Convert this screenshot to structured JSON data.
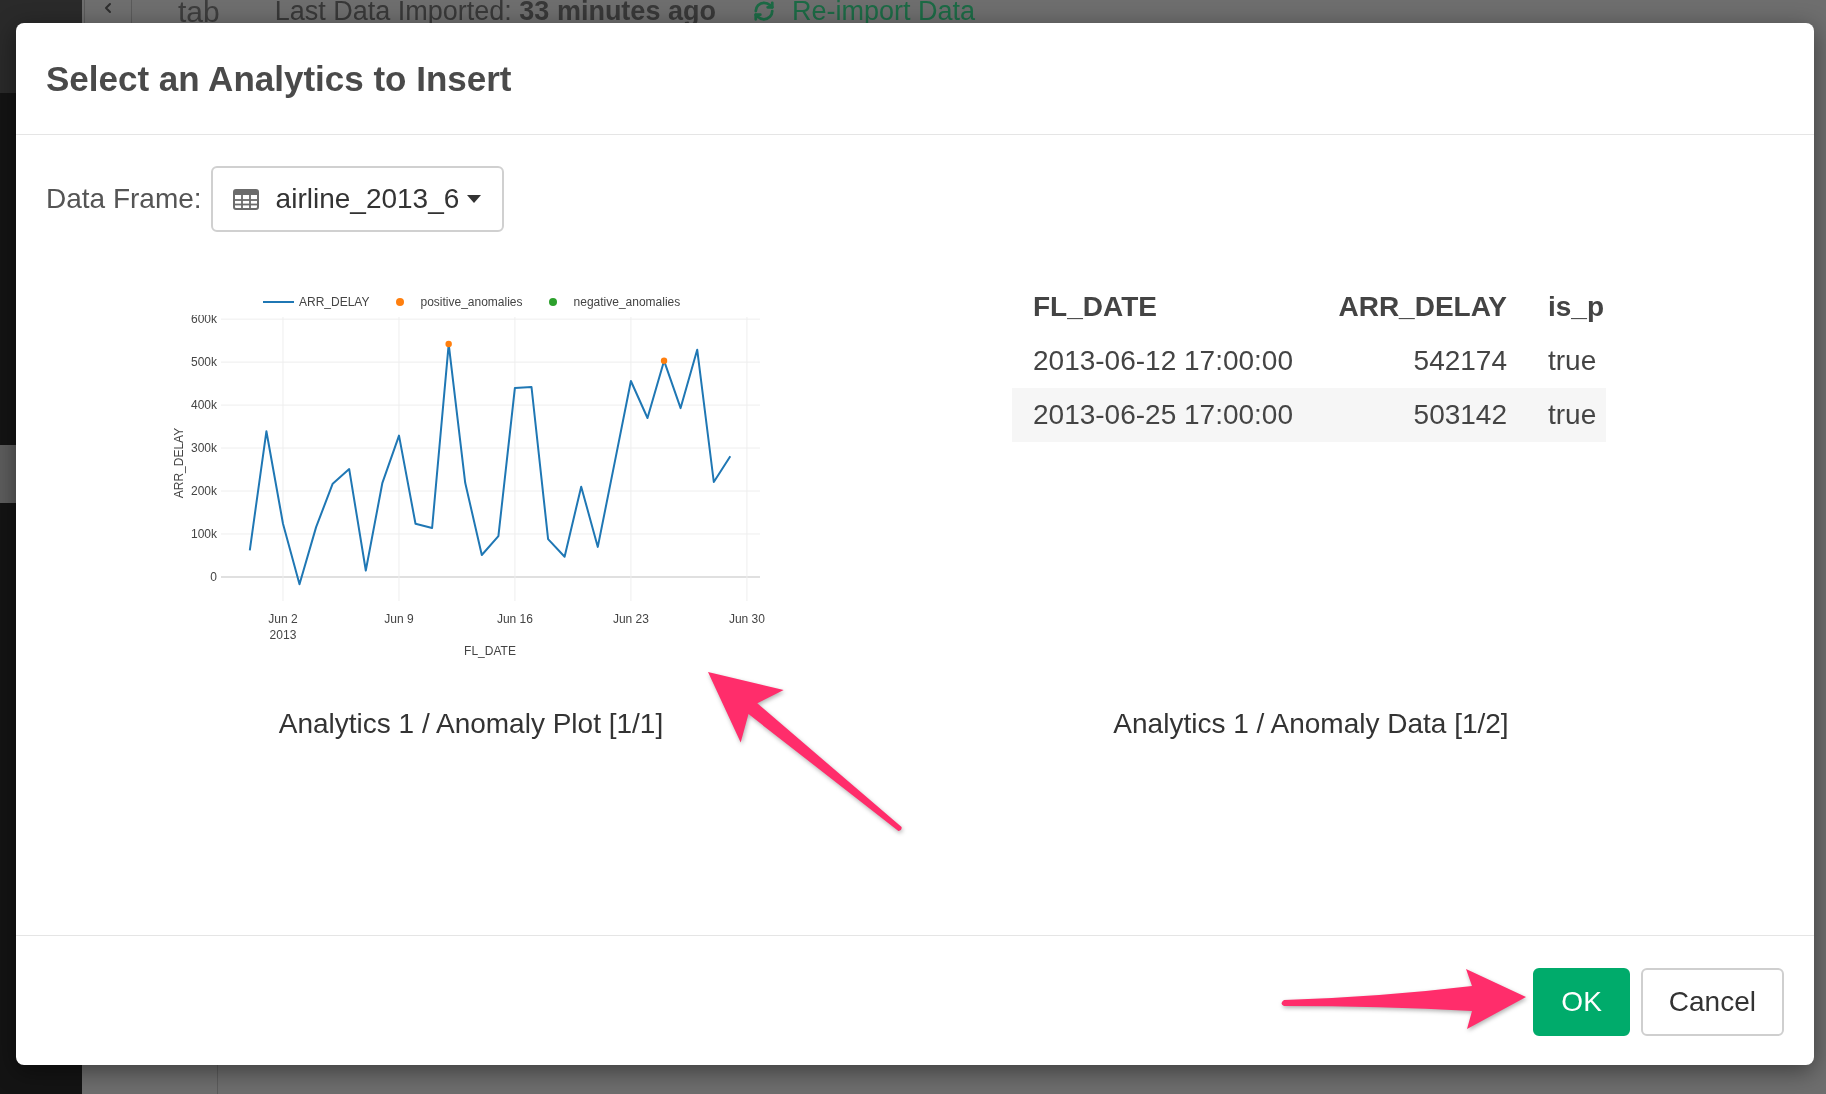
{
  "page": {
    "header": {
      "logo_fragment": "tab",
      "import_status": "Last Data Imported: **33 minutes ago**",
      "reimport_link": "Re-import Data"
    }
  },
  "dialog": {
    "title": "Select an Analytics to Insert",
    "data_frame": {
      "label": "Data Frame:",
      "value": "airline_2013_6"
    },
    "analytics": [
      {
        "kind": "plot",
        "caption": "Analytics 1 / Anomaly Plot [1/1]",
        "chart_data": {
          "type": "line",
          "xlabel": "FL_DATE",
          "ylabel": "ARR_DELAY",
          "grid": true,
          "legend": "top",
          "categories": [
            null,
            null,
            "Jun 2\n2013",
            null,
            null,
            null,
            null,
            null,
            null,
            "Jun 9",
            null,
            null,
            null,
            null,
            null,
            null,
            "Jun 16",
            null,
            null,
            null,
            null,
            null,
            null,
            "Jun 23",
            null,
            null,
            null,
            null,
            null,
            null,
            "Jun 30"
          ],
          "series": [
            {
              "name": "ARR_DELAY",
              "color": "#1f77b4",
              "values": [
                62000,
                339000,
                124000,
                -17000,
                116000,
                217000,
                251000,
                15000,
                219000,
                329000,
                124000,
                114000,
                542000,
                219000,
                51000,
                95000,
                440000,
                442000,
                88000,
                47000,
                210000,
                70000,
                263000,
                456000,
                370000,
                503000,
                393000,
                529000,
                221000,
                281000,
                null
              ]
            },
            {
              "name": "positive_anomalies",
              "type": "scatter",
              "color": "#ff7f0e",
              "values": [
                null,
                null,
                null,
                null,
                null,
                null,
                null,
                null,
                null,
                null,
                null,
                null,
                542000,
                null,
                null,
                null,
                null,
                null,
                null,
                null,
                null,
                null,
                null,
                null,
                null,
                503000,
                null,
                null,
                null,
                null,
                null
              ]
            },
            {
              "name": "negative_anomalies",
              "type": "scatter",
              "color": "#2ca02c",
              "values": [
                null,
                null,
                null,
                null,
                null,
                null,
                null,
                null,
                null,
                null,
                null,
                null,
                null,
                null,
                null,
                null,
                null,
                null,
                null,
                null,
                null,
                null,
                null,
                null,
                null,
                null,
                null,
                null,
                null,
                null,
                null
              ]
            }
          ],
          "ylim": [
            -56000,
            605000
          ],
          "yticks": [
            0,
            {
              "value": 100000,
              "label": "100k"
            },
            {
              "value": 200000,
              "label": "200k"
            },
            {
              "value": 300000,
              "label": "300k"
            },
            {
              "value": 400000,
              "label": "400k"
            },
            {
              "value": 500000,
              "label": "500k"
            },
            {
              "value": 600000,
              "label": "600k"
            }
          ]
        }
      },
      {
        "kind": "table",
        "caption": "Analytics 1 / Anomaly Data [1/2]",
        "table": {
          "columns": [
            {
              "label": "FL_DATE",
              "kind": "text"
            },
            {
              "label": "ARR_DELAY",
              "kind": "number"
            },
            {
              "label": "is_p",
              "kind": "text"
            }
          ],
          "rows": [
            [
              "2013-06-12 17:00:00",
              "542174",
              "true"
            ],
            [
              "2013-06-25 17:00:00",
              "503142",
              "true"
            ]
          ]
        }
      }
    ],
    "buttons": [
      {
        "kind": "primary",
        "label": "OK"
      },
      {
        "kind": "secondary",
        "label": "Cancel"
      }
    ]
  }
}
